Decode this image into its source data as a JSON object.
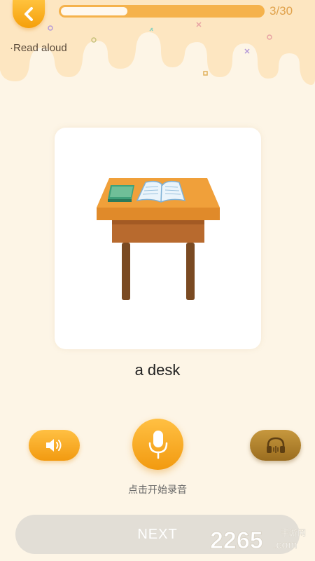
{
  "header": {
    "progress": {
      "current": 3,
      "total": 30,
      "label": "3/30",
      "fill_fraction": 0.33
    },
    "section_label": "·Read aloud",
    "back_icon": "chevron-left-icon"
  },
  "card": {
    "image_icon": "desk-illustration",
    "word": "a desk"
  },
  "controls": {
    "speaker_icon": "speaker-icon",
    "mic_icon": "microphone-icon",
    "headphone_icon": "headphones-icon",
    "record_hint": "点击开始录音"
  },
  "footer": {
    "next_label": "NEXT",
    "watermark": "2265.com 手游网"
  },
  "colors": {
    "accent": "#f5a623",
    "background": "#fdf5e6",
    "header": "#fde9c6",
    "disabled_button": "#e2ded6",
    "headphone_button": "#a8782a"
  }
}
